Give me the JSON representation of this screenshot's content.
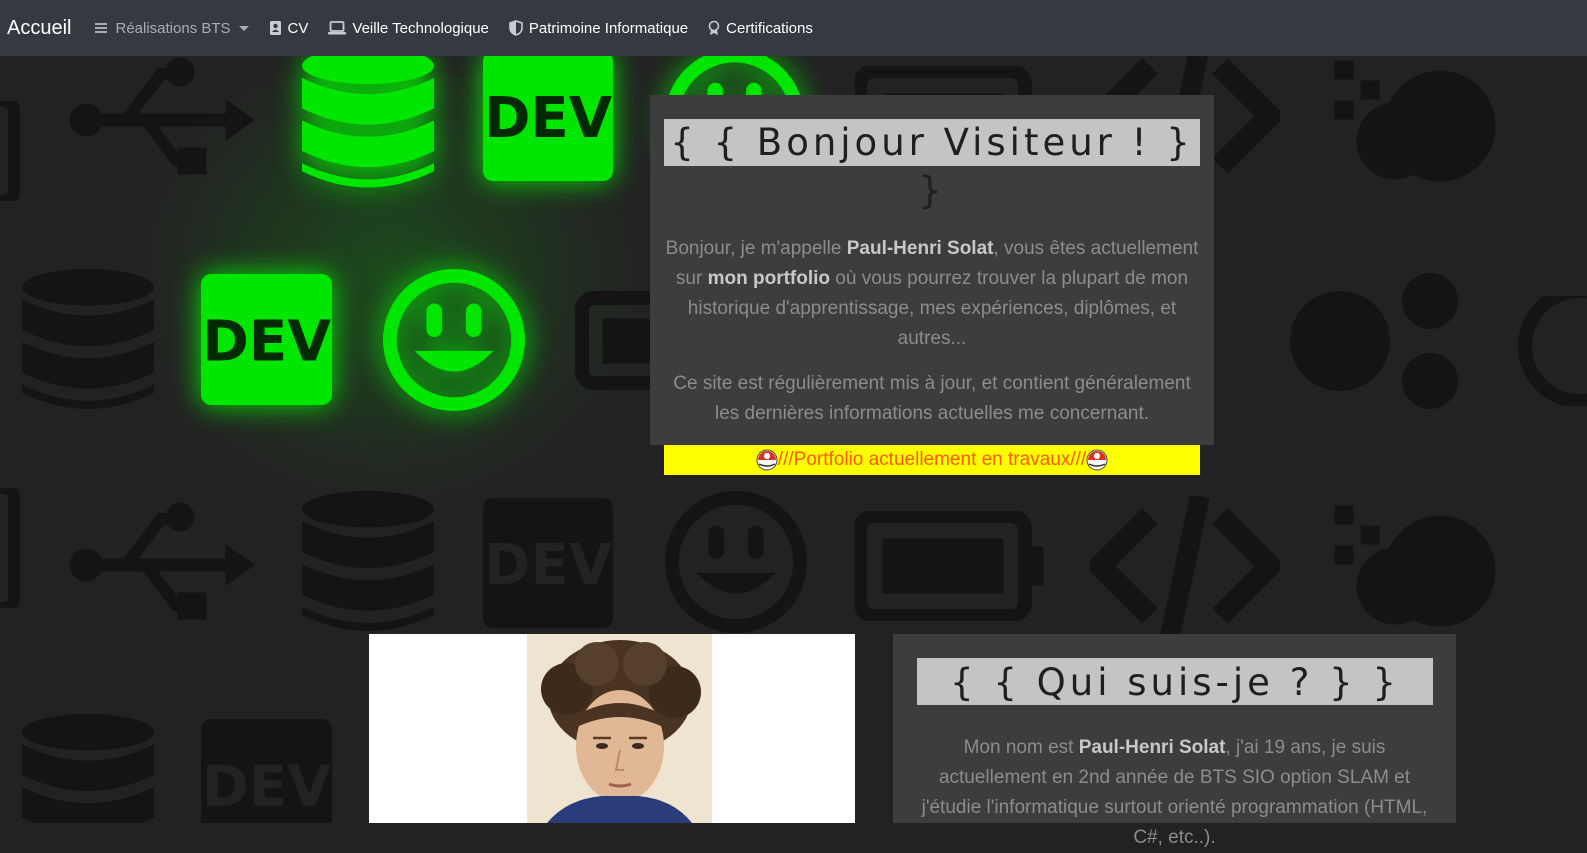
{
  "navbar": {
    "brand": "Accueil",
    "items": [
      {
        "label": "Réalisations BTS",
        "icon": "menu-icon",
        "dropdown": true
      },
      {
        "label": "CV",
        "icon": "contact-card-icon"
      },
      {
        "label": "Veille Technologique",
        "icon": "laptop-icon"
      },
      {
        "label": "Patrimoine Informatique",
        "icon": "shield-icon"
      },
      {
        "label": "Certifications",
        "icon": "award-icon"
      }
    ]
  },
  "hello": {
    "title": "{ { Bonjour Visiteur ! } }",
    "p1_a": "Bonjour, je m'appelle ",
    "p1_name": "Paul-Henri Solat",
    "p1_b": ", vous êtes actuellement sur ",
    "p1_bold": "mon portfolio",
    "p1_c": " où vous pourrez trouver la plupart de mon historique d'apprentissage, mes expériences, diplômes, et autres...",
    "p2": "Ce site est régulièrement mis à jour, et contient généralement les dernières informations actuelles me concernant.",
    "banner": "///Portfolio actuellement en travaux///"
  },
  "who": {
    "title": "{ { Qui suis-je ? } }",
    "p_a": "Mon nom est ",
    "p_name": "Paul-Henri Solat",
    "p_b": ", j'ai 19 ans, je suis actuellement en 2nd année de BTS SIO option SLAM et j'étudie l'informatique surtout orienté programmation (HTML, C#, etc..)."
  },
  "colors": {
    "navbar": "#343a40",
    "background": "#222222",
    "panel": "#3d3d3d",
    "accent_green": "#00e600",
    "banner_bg": "#ffff00",
    "banner_text": "#ff5a00"
  },
  "background_icons": [
    "usb-icon",
    "database-icon",
    "dev-icon",
    "smiley-icon",
    "battery-icon",
    "code-icon",
    "cloud-icon",
    "gear-icon",
    "chat-icon"
  ]
}
